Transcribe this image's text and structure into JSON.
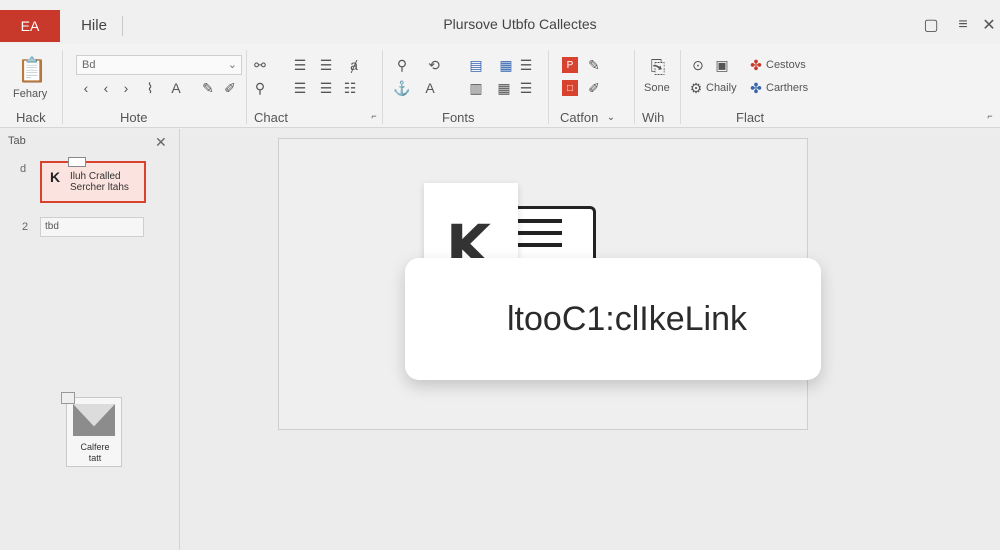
{
  "titlebar": {
    "app_badge": "EA",
    "file_tab": "Hile",
    "title": "Plursove Utbfo Callectes"
  },
  "ribbon": {
    "paste_label": "Fehary",
    "font_name": "Bd",
    "groups": [
      "Hack",
      "Hote",
      "Chact",
      "Fonts",
      "Catfon",
      "Wih",
      "Flact"
    ],
    "save_label": "Sone",
    "options": {
      "customize": "Cestovs",
      "quality": "Chaily",
      "carthers": "Carthers"
    }
  },
  "panel": {
    "header": "Tab",
    "slides": [
      {
        "number": "d",
        "letter": "K",
        "text_line1": "Iluh Cralled",
        "text_line2": "Sercher ltahs"
      },
      {
        "number": "2",
        "text": "tbd"
      }
    ],
    "file_icon_label_line1": "Calfere",
    "file_icon_label_line2": "tatt"
  },
  "canvas": {
    "doc_letter": "K",
    "link_text": "ltooC1:clIkeLink"
  }
}
